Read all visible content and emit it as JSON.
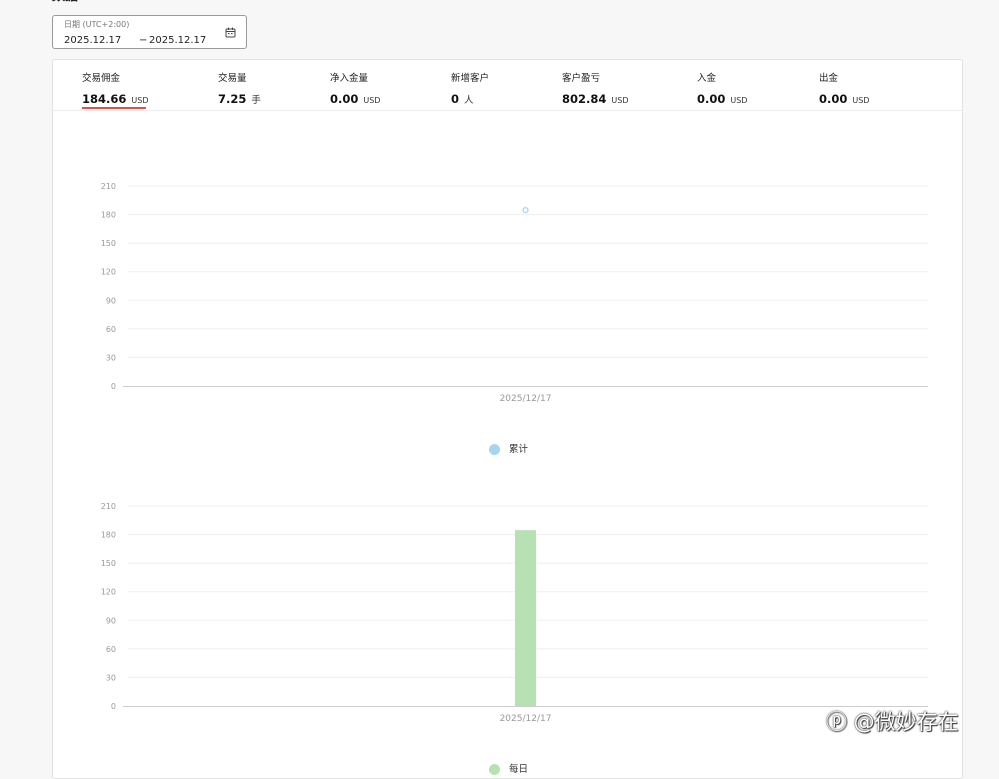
{
  "header": {
    "section_title_fragment": "数据"
  },
  "date_filter": {
    "label": "日期 (UTC+2:00)",
    "start": "2025.12.17",
    "separator": "−",
    "end": "2025.12.17",
    "icon": "calendar-icon"
  },
  "metrics": [
    {
      "label": "交易佣金",
      "value": "184.66",
      "unit": "USD",
      "active": true
    },
    {
      "label": "交易量",
      "value": "7.25",
      "unit": "手"
    },
    {
      "label": "净入金量",
      "value": "0.00",
      "unit": "USD"
    },
    {
      "label": "新增客户",
      "value": "0",
      "unit": "人"
    },
    {
      "label": "客户盈亏",
      "value": "802.84",
      "unit": "USD"
    },
    {
      "label": "入金",
      "value": "0.00",
      "unit": "USD"
    },
    {
      "label": "出金",
      "value": "0.00",
      "unit": "USD"
    }
  ],
  "colors": {
    "accent_underline": "#d9534f",
    "cumulative_series": "#a8d4f2",
    "daily_series": "#b7e0b3"
  },
  "chart_data": [
    {
      "type": "scatter",
      "categories": [
        "2025/12/17"
      ],
      "series": [
        {
          "name": "累计",
          "values": [
            184.66
          ]
        }
      ],
      "yticks": [
        0,
        30,
        60,
        90,
        120,
        150,
        180,
        210
      ],
      "ylim": [
        0,
        210
      ],
      "legend": "bottom-center",
      "grid": true
    },
    {
      "type": "bar",
      "categories": [
        "2025/12/17"
      ],
      "series": [
        {
          "name": "每日",
          "values": [
            184.66
          ]
        }
      ],
      "yticks": [
        0,
        30,
        60,
        90,
        120,
        150,
        180,
        210
      ],
      "ylim": [
        0,
        210
      ],
      "legend": "bottom-center",
      "grid": true
    }
  ],
  "watermark": "ⓟ @微妙存在"
}
